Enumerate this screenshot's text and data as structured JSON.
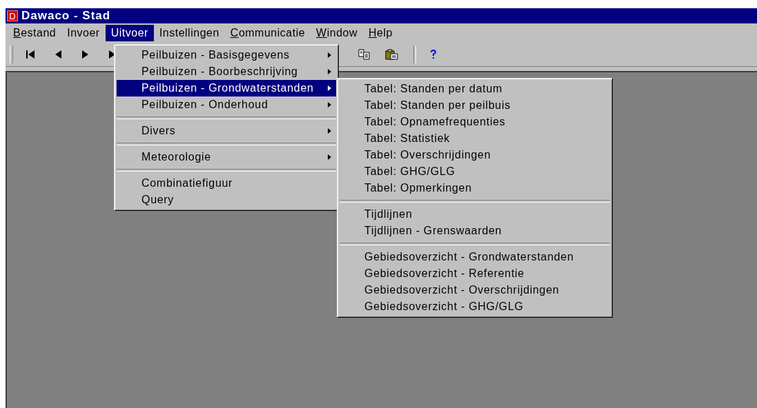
{
  "window": {
    "icon_letter": "D",
    "title": "Dawaco - Stad"
  },
  "menu_bar": [
    {
      "label": "Bestand",
      "mnemonic_first": true,
      "selected": false
    },
    {
      "label": "Invoer",
      "mnemonic_first": false,
      "selected": false
    },
    {
      "label": "Uitvoer",
      "mnemonic_first": false,
      "selected": true
    },
    {
      "label": "Instellingen",
      "mnemonic_first": false,
      "selected": false
    },
    {
      "label": "Communicatie",
      "mnemonic_first": true,
      "selected": false
    },
    {
      "label": "Window",
      "mnemonic_first": true,
      "selected": false
    },
    {
      "label": "Help",
      "mnemonic_first": true,
      "selected": false
    }
  ],
  "toolbar": [
    {
      "kind": "first"
    },
    {
      "kind": "prev"
    },
    {
      "kind": "next"
    },
    {
      "kind": "last"
    },
    {
      "kind": "copy"
    },
    {
      "kind": "paste"
    },
    {
      "kind": "separator"
    },
    {
      "kind": "help"
    }
  ],
  "dropdown_menu": [
    {
      "kind": "item",
      "label": "Peilbuizen - Basisgegevens",
      "has_submenu": true,
      "selected": false
    },
    {
      "kind": "item",
      "label": "Peilbuizen - Boorbeschrijving",
      "has_submenu": true,
      "selected": false
    },
    {
      "kind": "item",
      "label": "Peilbuizen - Grondwaterstanden",
      "has_submenu": true,
      "selected": true
    },
    {
      "kind": "item",
      "label": "Peilbuizen - Onderhoud",
      "has_submenu": true,
      "selected": false
    },
    {
      "kind": "separator"
    },
    {
      "kind": "item",
      "label": "Divers",
      "has_submenu": true,
      "selected": false
    },
    {
      "kind": "separator"
    },
    {
      "kind": "item",
      "label": "Meteorologie",
      "has_submenu": true,
      "selected": false
    },
    {
      "kind": "separator"
    },
    {
      "kind": "item",
      "label": "Combinatiefiguur",
      "has_submenu": false,
      "selected": false
    },
    {
      "kind": "item",
      "label": "Query",
      "has_submenu": false,
      "selected": false
    }
  ],
  "submenu": [
    {
      "kind": "item",
      "label": "Tabel: Standen per datum",
      "has_submenu": false,
      "selected": false
    },
    {
      "kind": "item",
      "label": "Tabel: Standen per peilbuis",
      "has_submenu": false,
      "selected": false
    },
    {
      "kind": "item",
      "label": "Tabel: Opnamefrequenties",
      "has_submenu": false,
      "selected": false
    },
    {
      "kind": "item",
      "label": "Tabel: Statistiek",
      "has_submenu": false,
      "selected": false
    },
    {
      "kind": "item",
      "label": "Tabel: Overschrijdingen",
      "has_submenu": false,
      "selected": false
    },
    {
      "kind": "item",
      "label": "Tabel: GHG/GLG",
      "has_submenu": false,
      "selected": false
    },
    {
      "kind": "item",
      "label": "Tabel: Opmerkingen",
      "has_submenu": false,
      "selected": false
    },
    {
      "kind": "separator"
    },
    {
      "kind": "item",
      "label": "Tijdlijnen",
      "has_submenu": false,
      "selected": false
    },
    {
      "kind": "item",
      "label": "Tijdlijnen - Grenswaarden",
      "has_submenu": false,
      "selected": false
    },
    {
      "kind": "separator"
    },
    {
      "kind": "item",
      "label": "Gebiedsoverzicht - Grondwaterstanden",
      "has_submenu": false,
      "selected": false
    },
    {
      "kind": "item",
      "label": "Gebiedsoverzicht - Referentie",
      "has_submenu": false,
      "selected": false
    },
    {
      "kind": "item",
      "label": "Gebiedsoverzicht - Overschrijdingen",
      "has_submenu": false,
      "selected": false
    },
    {
      "kind": "item",
      "label": "Gebiedsoverzicht - GHG/GLG",
      "has_submenu": false,
      "selected": false
    }
  ]
}
